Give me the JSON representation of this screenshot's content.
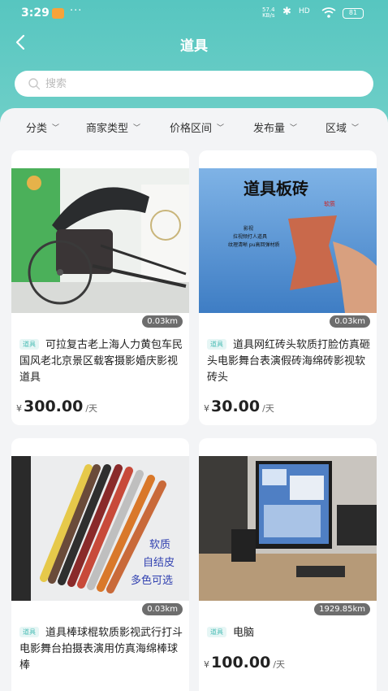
{
  "status_bar": {
    "time": "3:29",
    "more": "···",
    "net_speed_top": "57.4",
    "net_speed_bottom": "KB/s",
    "signal": "HD",
    "battery": "81"
  },
  "nav": {
    "title": "道具"
  },
  "search": {
    "placeholder": "搜索"
  },
  "filters": [
    {
      "label": "分类"
    },
    {
      "label": "商家类型"
    },
    {
      "label": "价格区间"
    },
    {
      "label": "发布量"
    },
    {
      "label": "区域"
    }
  ],
  "products": [
    {
      "distance": "0.03km",
      "tag": "道具",
      "title": "可拉复古老上海人力黄包车民国风老北京景区载客摄影婚庆影视道具",
      "currency": "¥",
      "price": "300.00",
      "unit": "/天"
    },
    {
      "distance": "0.03km",
      "tag": "道具",
      "title": "道具网红砖头软质打脸仿真砸头电影舞台表演假砖海绵砖影视软砖头",
      "currency": "¥",
      "price": "30.00",
      "unit": "/天",
      "image_text": {
        "heading": "道具板砖",
        "sub": "软质",
        "lines": [
          "影视",
          "拉视频打人道具",
          "纹理清晰 pu高回弹材质"
        ]
      }
    },
    {
      "distance": "0.03km",
      "tag": "道具",
      "title": "道具棒球棍软质影视武行打斗电影舞台拍摄表演用仿真海绵棒球棒",
      "image_text": {
        "lines": [
          "软质",
          "自结皮",
          "多色可选"
        ]
      }
    },
    {
      "distance": "1929.85km",
      "tag": "道具",
      "title": "电脑",
      "currency": "¥",
      "price": "100.00",
      "unit": "/天"
    }
  ]
}
